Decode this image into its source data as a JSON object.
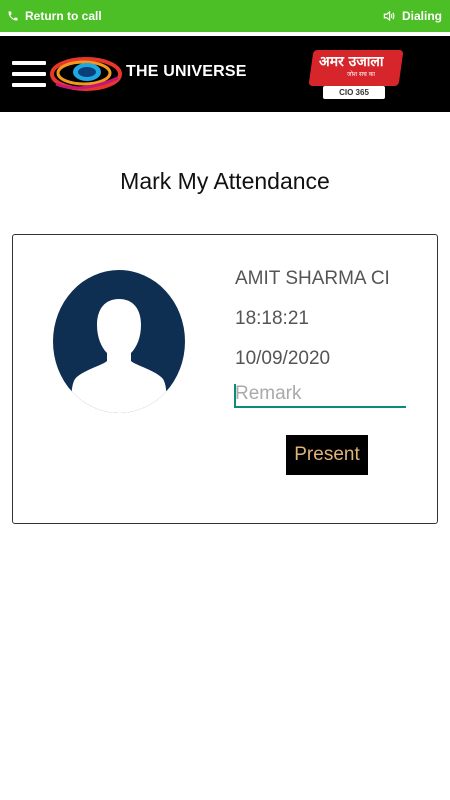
{
  "call_bar": {
    "left_label": "Return to call",
    "right_label": "Dialing",
    "background": "#4cbf26",
    "left_icon": "phone-icon",
    "right_icon": "speaker-icon"
  },
  "header": {
    "menu_icon": "hamburger-menu-icon",
    "logo_icon": "universe-logo-icon",
    "brand": "THE UNIVERSE",
    "partner": {
      "title": "अमर उजाला",
      "tagline": "जोश सच का",
      "badge": "CIO 365",
      "color": "#d7262b"
    }
  },
  "page": {
    "title": "Mark My Attendance"
  },
  "attendance": {
    "avatar_icon": "user-avatar-icon",
    "name": "AMIT SHARMA CI",
    "time": "18:18:21",
    "date": "10/09/2020",
    "remark_placeholder": "Remark",
    "remark_value": "",
    "present_label": "Present",
    "accent": "#0d8a7a",
    "button_text_color": "#e0b27a"
  }
}
